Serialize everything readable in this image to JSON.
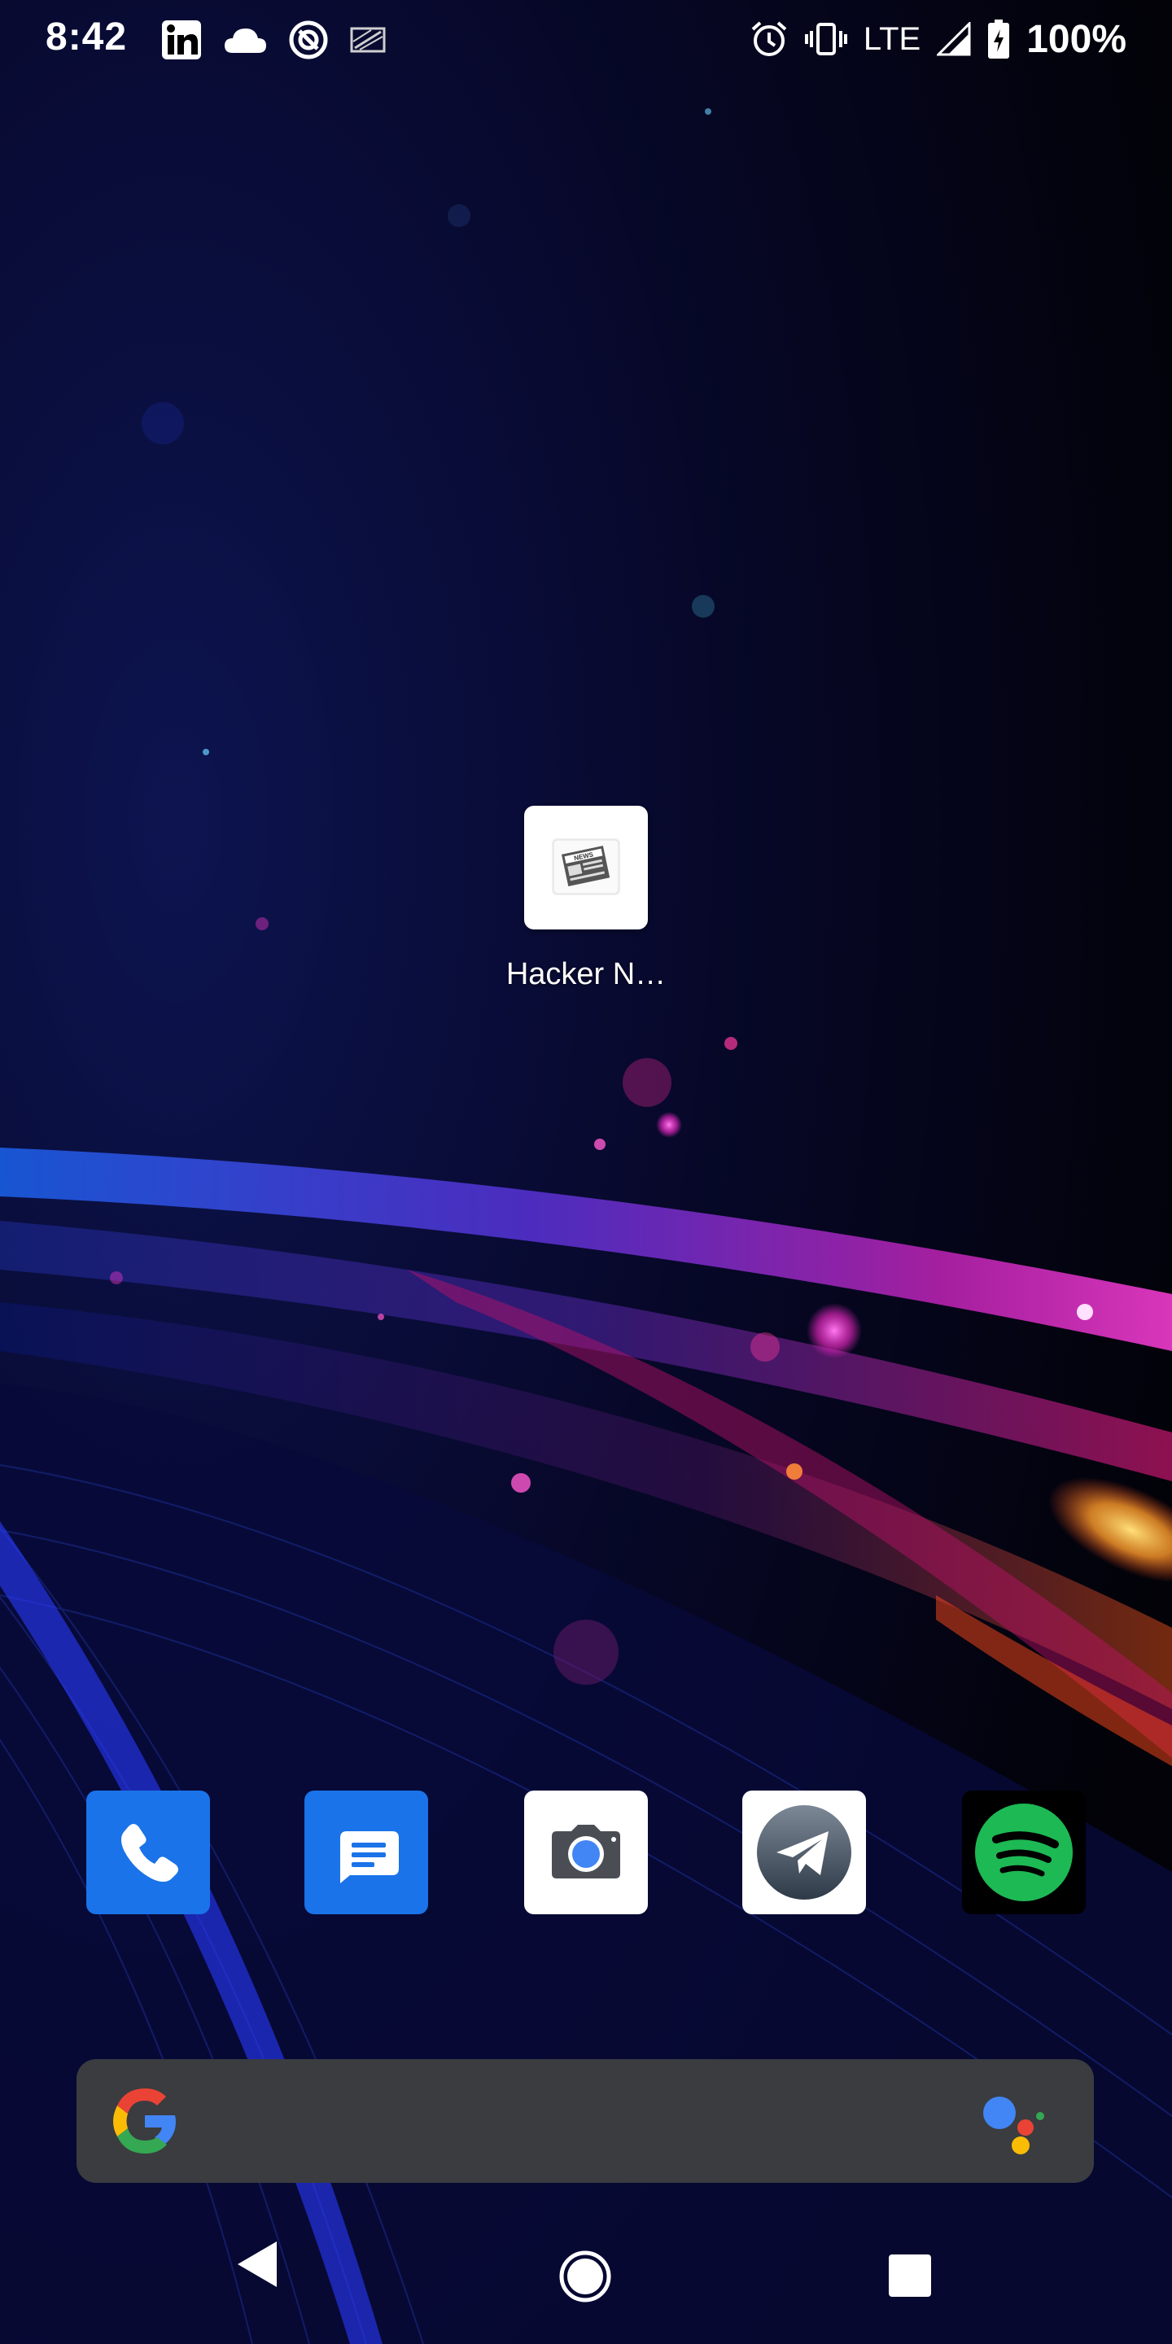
{
  "status_bar": {
    "time": "8:42",
    "network": "LTE",
    "battery": "100%",
    "left_icons": [
      "linkedin-icon",
      "cloud-icon",
      "sync-icon",
      "cast-off-icon"
    ],
    "right_icons": [
      "alarm-icon",
      "vibrate-icon",
      "signal-icon",
      "battery-charging-icon"
    ]
  },
  "home": {
    "shortcut": {
      "label": "Hacker N…",
      "icon": "newspaper-icon"
    }
  },
  "dock": [
    {
      "app": "phone",
      "icon": "phone-icon",
      "color": "#1a73e8"
    },
    {
      "app": "messages",
      "icon": "message-icon",
      "color": "#1a73e8"
    },
    {
      "app": "camera",
      "icon": "camera-icon",
      "color": "#ffffff"
    },
    {
      "app": "telegram",
      "icon": "paper-plane-icon",
      "color": "#ffffff"
    },
    {
      "app": "spotify",
      "icon": "spotify-icon",
      "color": "#1db954"
    }
  ],
  "search_bar": {
    "left_icon": "google-g-icon",
    "right_icon": "google-assistant-icon",
    "colors": {
      "blue": "#4285f4",
      "red": "#ea4335",
      "yellow": "#fbbc05",
      "green": "#34a853"
    }
  },
  "nav_bar": {
    "buttons": [
      "back-button",
      "home-button",
      "recents-button"
    ]
  }
}
